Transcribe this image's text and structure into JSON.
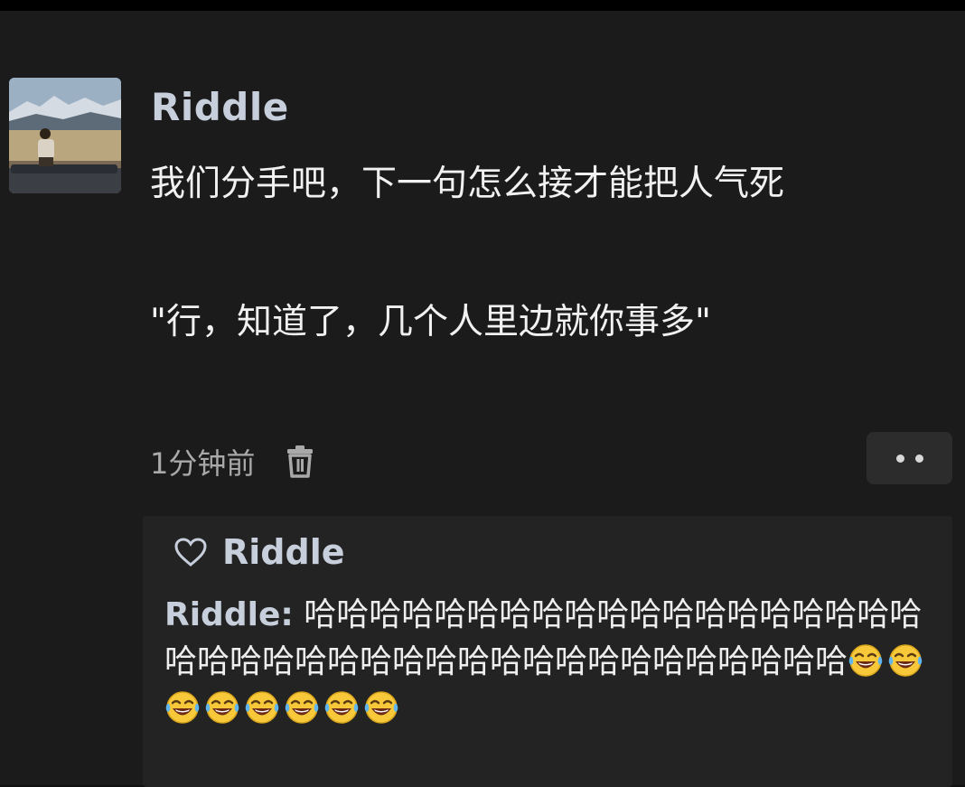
{
  "post": {
    "username": "Riddle",
    "content_line1": "我们分手吧，下一句怎么接才能把人气死",
    "content_line2": "\"行，知道了，几个人里边就你事多\"",
    "timestamp": "1分钟前",
    "delete_icon": "trash-icon",
    "more_icon": "more-dots-icon"
  },
  "comments": {
    "likes": {
      "icon": "heart-outline-icon",
      "name": "Riddle"
    },
    "items": [
      {
        "author": "Riddle:",
        "text": "哈哈哈哈哈哈哈哈哈哈哈哈哈哈哈哈哈哈哈哈哈哈哈哈哈哈哈哈哈哈哈哈哈哈哈哈哈哈哈哈",
        "emoji": "laughing-tears-emoji",
        "emoji_count": 8
      }
    ]
  },
  "colors": {
    "background": "#1b1b1b",
    "username": "#c6cfdb",
    "text": "#f1f1f1",
    "meta": "#a9a9a9",
    "comment_panel": "#232323"
  }
}
